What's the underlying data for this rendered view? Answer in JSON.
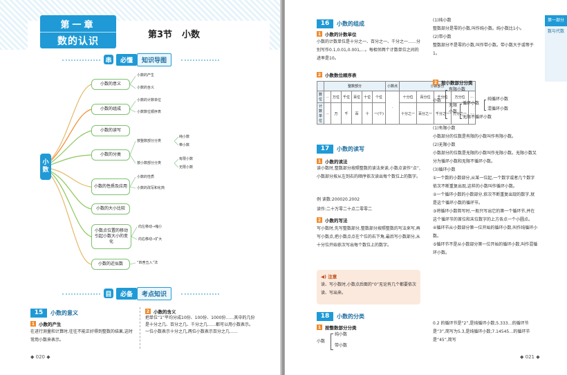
{
  "left": {
    "chapter_num": "第一章",
    "chapter_title": "数的认识",
    "section_label": "第3节",
    "section_title": "小数",
    "banner1": {
      "icon": "串",
      "a": "必懂",
      "b": "知识导图"
    },
    "banner2": {
      "icon": "目",
      "a": "必备",
      "b": "考点知识"
    },
    "root": "小数",
    "branches": [
      {
        "label": "小数的意义",
        "leaves": [
          "小数的产生",
          "小数的含义"
        ]
      },
      {
        "label": "小数的组成",
        "leaves": [
          "小数的计数单位",
          "小数数位顺序表"
        ]
      },
      {
        "label": "小数的读写",
        "leaves": []
      },
      {
        "label": "小数的分类",
        "leaves": [
          "按整数部分分类",
          "按小数部分分类"
        ]
      },
      {
        "label": "小数的性质及应用",
        "leaves": [
          "小数的性质",
          "小数的改写和化简"
        ]
      },
      {
        "label": "小数的大小比较",
        "leaves": []
      },
      {
        "label": "小数点位置的移动引起小数大小的变化",
        "leaves": [
          "向左移动→缩小",
          "向右移动→扩大"
        ]
      },
      {
        "label": "小数的近似数",
        "leaves": [
          "“四舍五入”法"
        ]
      }
    ],
    "subleaves": {
      "int_class": [
        "纯小数",
        "带小数"
      ],
      "dec_class": [
        "有限小数",
        "无限小数"
      ]
    },
    "sec15": {
      "num": "15",
      "title": "小数的意义"
    },
    "sub1": {
      "k": "1",
      "title": "小数的产生",
      "text": "在进行测量和计算时,往往不能正好得到整数的结果,这时常用小数来表示。"
    },
    "sub2": {
      "k": "2",
      "title": "小数的含义",
      "text": "把单位“1”平均分成10份、100份、1000份……其中的几份是十分之几、百分之几、千分之几……都可以用小数表示。一位小数表示十分之几,两位小数表示百分之几……"
    },
    "page_no": "020"
  },
  "right": {
    "sec16": {
      "num": "16",
      "title": "小数的组成"
    },
    "s16_1": {
      "k": "1",
      "title": "小数的计数单位",
      "text": "小数的计数单位是十分之一、百分之一、千分之一……分别写作0.1,0.01,0.001,…。每相邻两个计数单位之间的进率是10。"
    },
    "s16_2": {
      "k": "2",
      "title": "小数数位顺序表"
    },
    "table": {
      "h1": [
        "整数部分",
        "小数点",
        "小数部分"
      ],
      "row1_label": "数位",
      "row2_label": "计数单位",
      "digits": [
        "…",
        "万位",
        "千位",
        "百位",
        "十位",
        "个位",
        "·",
        "十分位",
        "百分位",
        "千分位",
        "万分位",
        "…"
      ],
      "units": [
        "…",
        "万",
        "千",
        "百",
        "十",
        "一(个)",
        "",
        "十分之一",
        "百分之一",
        "千分之一",
        "万分之一",
        "…"
      ]
    },
    "sec17": {
      "num": "17",
      "title": "小数的读写"
    },
    "s17_1": {
      "k": "1",
      "title": "小数的读法",
      "text": "读小数时,整数部分按照整数的读法来读,小数点读作“点”,小数部分按从左到右的顺序依次读出每个数位上的数字。"
    },
    "eg": "例 读数:200020.2002",
    "eg_ans": "读作:二十万零二十点二零零二",
    "s17_2": {
      "k": "2",
      "title": "小数的写法",
      "text": "写小数时,先写整数部分,整数部分按照整数的写法来写,再写小数点,把小数点点在个位的右下角,最后写小数部分,从十分位开始依次写出每个数位上的数字。"
    },
    "note_title": "注意",
    "note_text": "读、写小数时,小数点后面的“0”无论有几个都要依次读、写出来。",
    "sec18": {
      "num": "18",
      "title": "小数的分类"
    },
    "s18_1": {
      "k": "1",
      "title": "按整数部分分类"
    },
    "cls1": {
      "root": "小数",
      "a": "纯小数",
      "b": "带小数"
    },
    "col2_text1": "(1)纯小数\n整数部分是零的小数,叫作纯小数。纯小数比1小。\n(2)带小数\n整数部分不是零的小数,叫作带小数。带小数大于或等于1。",
    "s18_2": {
      "k": "2",
      "title": "按小数部分分类"
    },
    "cls2": {
      "root": "小数",
      "a": "有限小数",
      "b": "无限小数",
      "c": "循环小数",
      "d": "纯循环小数",
      "e": "混循环小数",
      "f": "无限不循环小数"
    },
    "col2_text2": "(1)有限小数\n小数部分的位数是有限的小数叫作有限小数。\n(2)无限小数\n小数部分的位数是无限的小数叫作无限小数。无限小数又分为循环小数和无限不循环小数。\n(3)循环小数\n①一个数的小数部分,从某一位起,一个数字或者几个数字依次不断重复出现,这样的小数叫作循环小数。\n②一个循环小数的小数部分,依次不断重复出现的数字,就是这个循环小数的循环节。\n③将循环小数简写时,一般只写出它的第一个循环节,并在这个循环节的首位和末位数字的上方各点一个小圆点。\n④循环节从小数部分第一位开始的循环小数,叫作纯循环小数。\n⑤循环节不是从小数部分第一位开始的循环小数,叫作混循环小数。",
    "col2_text3": "0.2̇ 的循环节是“2”,是纯循环小数;5.333…的循环节是“3”,简写为5.3̇,是纯循环小数;7.14545…的循环节是“45”,简写",
    "tab1": "第一部分",
    "tab2": "数与代数",
    "page_no": "021"
  }
}
